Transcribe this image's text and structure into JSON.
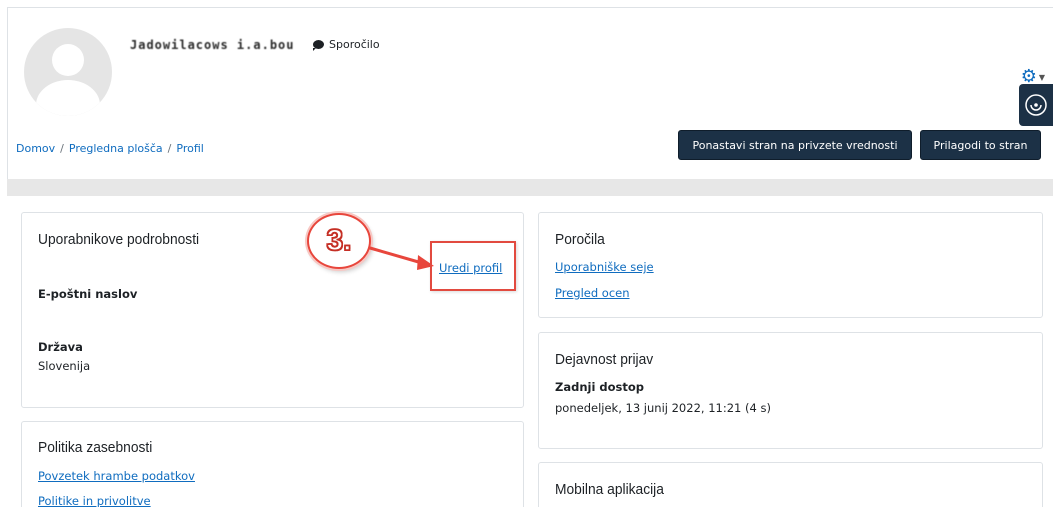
{
  "header": {
    "user_name": "Jadowilacows i.a.bou",
    "message_label": "Sporočilo"
  },
  "breadcrumb": {
    "items": [
      "Domov",
      "Pregledna plošča",
      "Profil"
    ],
    "separator": "/"
  },
  "buttons": {
    "reset_label": "Ponastavi stran na privzete vrednosti",
    "customize_label": "Prilagodi to stran"
  },
  "user_details": {
    "title": "Uporabnikove podrobnosti",
    "edit_link": "Uredi profil",
    "email_label": "E-poštni naslov",
    "country_label": "Država",
    "country_value": "Slovenija"
  },
  "privacy": {
    "title": "Politika zasebnosti",
    "links": [
      "Povzetek hrambe podatkov",
      "Politike in privolitve"
    ]
  },
  "reports": {
    "title": "Poročila",
    "links": [
      "Uporabniške seje",
      "Pregled ocen"
    ]
  },
  "login_activity": {
    "title": "Dejavnost prijav",
    "last_access_label": "Zadnji dostop",
    "last_access_value": "ponedeljek, 13 junij 2022, 11:21  (4 s)"
  },
  "mobile": {
    "title": "Mobilna aplikacija"
  },
  "annotation": {
    "step_label": "3."
  },
  "icons": {
    "message": "speech-bubble-icon",
    "gear": "gear-icon",
    "accessibility": "accessibility-icon"
  },
  "colors": {
    "link": "#0f6cbf",
    "button_bg": "#1c3146",
    "annotation_red": "#e8463c"
  }
}
